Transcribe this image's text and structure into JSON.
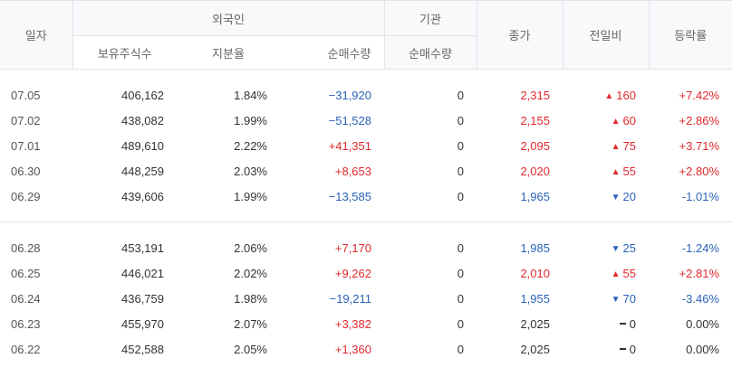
{
  "headers": {
    "date": "일자",
    "foreign": "외국인",
    "institution": "기관",
    "holdings": "보유주식수",
    "share_ratio": "지분율",
    "foreign_net": "순매수량",
    "inst_net": "순매수량",
    "close": "종가",
    "change": "전일비",
    "rate": "등락률"
  },
  "colors": {
    "up": "#e0282d",
    "down": "#2a63b8",
    "header_bg": "#f8f9fb",
    "border": "#e2e4e8"
  },
  "groups": [
    {
      "rows": [
        {
          "date": "07.05",
          "holdings": "406,162",
          "ratio": "1.84%",
          "net": "−31,920",
          "net_dir": "down",
          "inst": "0",
          "close": "2,315",
          "close_dir": "up",
          "change": "160",
          "change_dir": "up",
          "rate": "+7.42%",
          "rate_dir": "up"
        },
        {
          "date": "07.02",
          "holdings": "438,082",
          "ratio": "1.99%",
          "net": "−51,528",
          "net_dir": "down",
          "inst": "0",
          "close": "2,155",
          "close_dir": "up",
          "change": "60",
          "change_dir": "up",
          "rate": "+2.86%",
          "rate_dir": "up"
        },
        {
          "date": "07.01",
          "holdings": "489,610",
          "ratio": "2.22%",
          "net": "+41,351",
          "net_dir": "up",
          "inst": "0",
          "close": "2,095",
          "close_dir": "up",
          "change": "75",
          "change_dir": "up",
          "rate": "+3.71%",
          "rate_dir": "up"
        },
        {
          "date": "06.30",
          "holdings": "448,259",
          "ratio": "2.03%",
          "net": "+8,653",
          "net_dir": "up",
          "inst": "0",
          "close": "2,020",
          "close_dir": "up",
          "change": "55",
          "change_dir": "up",
          "rate": "+2.80%",
          "rate_dir": "up"
        },
        {
          "date": "06.29",
          "holdings": "439,606",
          "ratio": "1.99%",
          "net": "−13,585",
          "net_dir": "down",
          "inst": "0",
          "close": "1,965",
          "close_dir": "down",
          "change": "20",
          "change_dir": "down",
          "rate": "-1.01%",
          "rate_dir": "down"
        }
      ]
    },
    {
      "rows": [
        {
          "date": "06.28",
          "holdings": "453,191",
          "ratio": "2.06%",
          "net": "+7,170",
          "net_dir": "up",
          "inst": "0",
          "close": "1,985",
          "close_dir": "down",
          "change": "25",
          "change_dir": "down",
          "rate": "-1.24%",
          "rate_dir": "down"
        },
        {
          "date": "06.25",
          "holdings": "446,021",
          "ratio": "2.02%",
          "net": "+9,262",
          "net_dir": "up",
          "inst": "0",
          "close": "2,010",
          "close_dir": "up",
          "change": "55",
          "change_dir": "up",
          "rate": "+2.81%",
          "rate_dir": "up"
        },
        {
          "date": "06.24",
          "holdings": "436,759",
          "ratio": "1.98%",
          "net": "−19,211",
          "net_dir": "down",
          "inst": "0",
          "close": "1,955",
          "close_dir": "down",
          "change": "70",
          "change_dir": "down",
          "rate": "-3.46%",
          "rate_dir": "down"
        },
        {
          "date": "06.23",
          "holdings": "455,970",
          "ratio": "2.07%",
          "net": "+3,382",
          "net_dir": "up",
          "inst": "0",
          "close": "2,025",
          "close_dir": "flat",
          "change": "0",
          "change_dir": "flat",
          "rate": "0.00%",
          "rate_dir": "flat"
        },
        {
          "date": "06.22",
          "holdings": "452,588",
          "ratio": "2.05%",
          "net": "+1,360",
          "net_dir": "up",
          "inst": "0",
          "close": "2,025",
          "close_dir": "flat",
          "change": "0",
          "change_dir": "flat",
          "rate": "0.00%",
          "rate_dir": "flat"
        }
      ]
    }
  ]
}
